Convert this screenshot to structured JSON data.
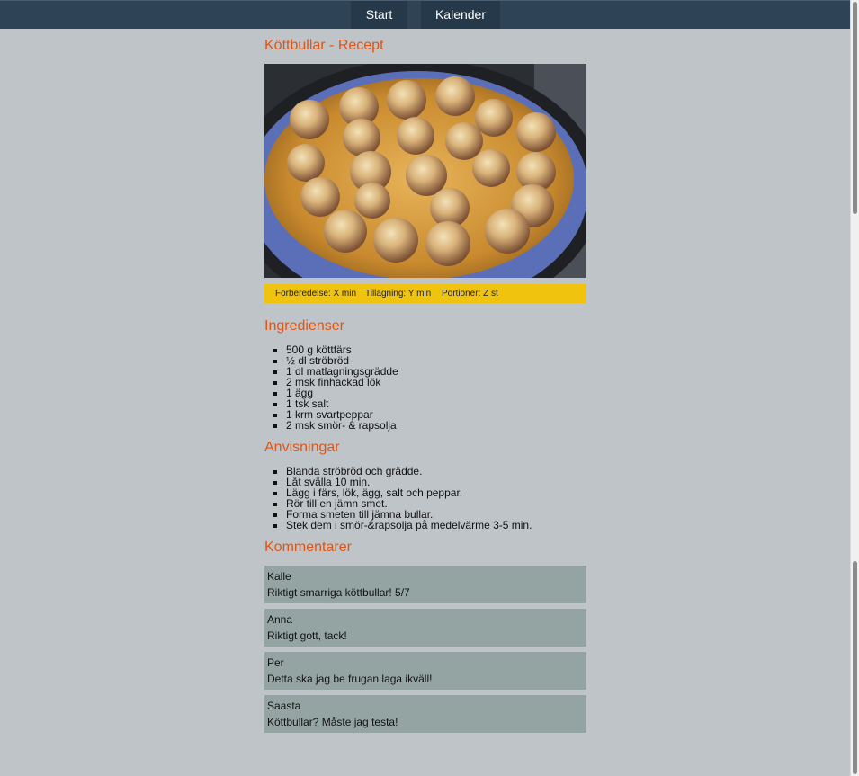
{
  "nav": {
    "start": "Start",
    "kalender": "Kalender"
  },
  "recipe": {
    "title": "Köttbullar - Recept",
    "info": {
      "prep": "Förberedelse: X min",
      "cook": "Tillagning: Y min",
      "portions": "Portioner: Z st"
    },
    "ingredients_heading": "Ingredienser",
    "ingredients": [
      "500 g köttfärs",
      "½ dl ströbröd",
      "1 dl matlagningsgrädde",
      "2 msk finhackad lök",
      "1 ägg",
      "1 tsk salt",
      "1 krm svartpeppar",
      "2 msk smör- & rapsolja"
    ],
    "instructions_heading": "Anvisningar",
    "instructions": [
      "Blanda ströbröd och grädde.",
      "Låt svälla 10 min.",
      "Lägg i färs, lök, ägg, salt och peppar.",
      "Rör till en jämn smet.",
      "Forma smeten till jämna bullar.",
      "Stek dem i smör-&rapsolja på medelvärme 3-5 min."
    ],
    "comments_heading": "Kommentarer",
    "comments": [
      {
        "name": "Kalle",
        "text": "Riktigt smarriga köttbullar! 5/7"
      },
      {
        "name": "Anna",
        "text": "Riktigt gott, tack!"
      },
      {
        "name": "Per",
        "text": "Detta ska jag be frugan laga ikväll!"
      },
      {
        "name": "Saasta",
        "text": "Köttbullar? Måste jag testa!"
      }
    ]
  },
  "colors": {
    "nav_bg": "#2f4356",
    "accent_heading": "#e25412",
    "info_bar": "#f0c30f",
    "comment_bg": "#94a4a3",
    "page_bg": "#bfc4c9"
  }
}
